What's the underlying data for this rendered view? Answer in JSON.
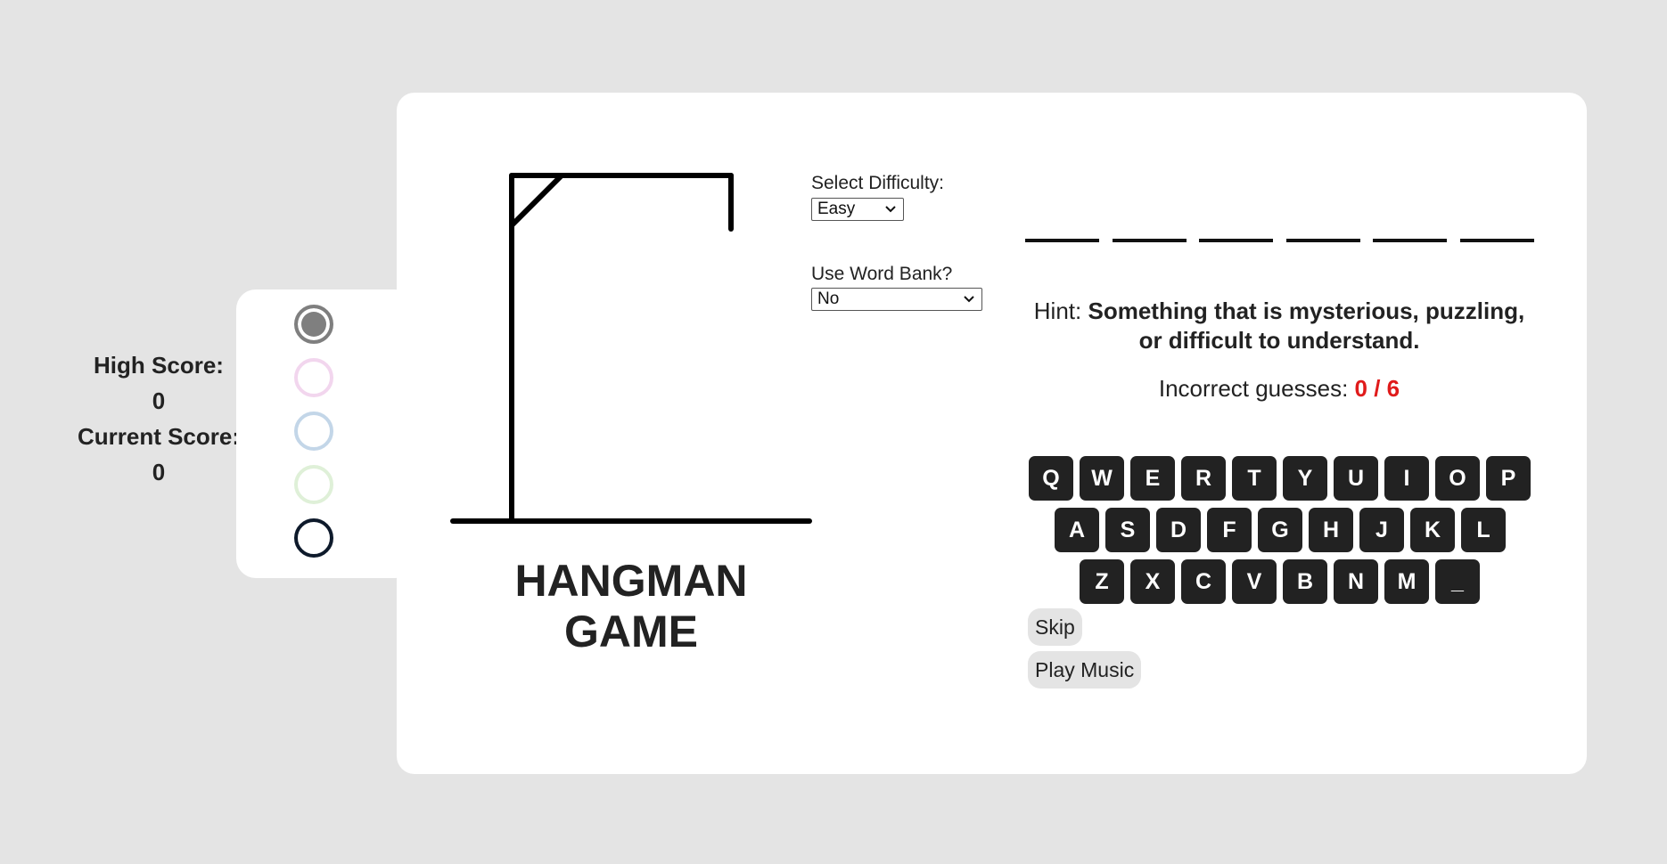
{
  "scores": {
    "high_score_label": "High Score:",
    "high_score_value": "0",
    "current_score_label": "Current Score:",
    "current_score_value": "0"
  },
  "themes": [
    {
      "name": "gray",
      "color": "#7f7f7f",
      "selected": true
    },
    {
      "name": "pink",
      "color": "#f2d6ee",
      "selected": false
    },
    {
      "name": "blue",
      "color": "#c3d6e8",
      "selected": false
    },
    {
      "name": "green",
      "color": "#dff0d8",
      "selected": false
    },
    {
      "name": "navy",
      "color": "#0e1a2b",
      "selected": false
    }
  ],
  "game": {
    "title_line1": "HANGMAN",
    "title_line2": "GAME",
    "incorrect_guesses": 0,
    "max_guesses": 6
  },
  "settings": {
    "difficulty_label": "Select Difficulty:",
    "difficulty_value": "Easy",
    "word_bank_label": "Use Word Bank?",
    "word_bank_value": "No"
  },
  "word": {
    "length": 6,
    "revealed": [
      "",
      "",
      "",
      "",
      "",
      ""
    ]
  },
  "hint": {
    "label": "Hint:",
    "text": "Something that is mysterious, puzzling, or difficult to understand."
  },
  "guesses": {
    "label": "Incorrect guesses:",
    "count_text": "0 / 6"
  },
  "keyboard": {
    "rows": [
      [
        "Q",
        "W",
        "E",
        "R",
        "T",
        "Y",
        "U",
        "I",
        "O",
        "P"
      ],
      [
        "A",
        "S",
        "D",
        "F",
        "G",
        "H",
        "J",
        "K",
        "L"
      ],
      [
        "Z",
        "X",
        "C",
        "V",
        "B",
        "N",
        "M",
        "_"
      ]
    ]
  },
  "buttons": {
    "skip": "Skip",
    "play_music": "Play Music"
  },
  "colors": {
    "background": "#e4e4e4",
    "card": "#ffffff",
    "key": "#222222",
    "error_count": "#e01b1b"
  }
}
